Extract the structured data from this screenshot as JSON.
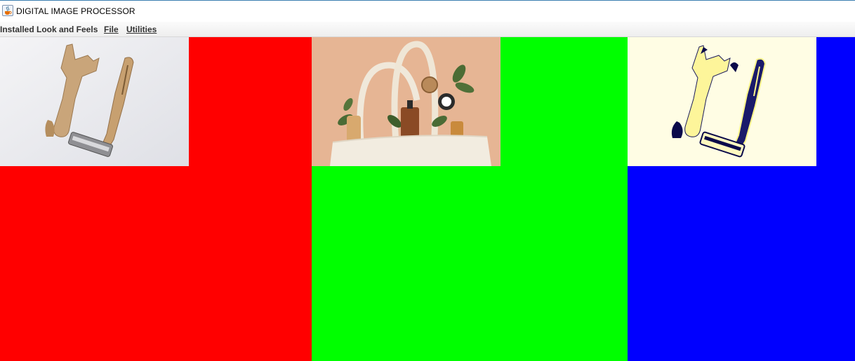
{
  "window": {
    "title": "DIGITAL IMAGE PROCESSOR",
    "icon": "java-cup-icon"
  },
  "menubar": {
    "items": [
      {
        "label": "Installed Look and Feels"
      },
      {
        "label": "File",
        "mnemonic": "F"
      },
      {
        "label": "Utilities",
        "mnemonic": "U"
      }
    ]
  },
  "panels": [
    {
      "name": "red-panel",
      "color": "#ff0000",
      "image": "razor-original-photo"
    },
    {
      "name": "green-panel",
      "color": "#00ff00",
      "image": "tote-bag-cosmetics-photo"
    },
    {
      "name": "blue-panel",
      "color": "#0000ff",
      "image": "razor-inverted-photo"
    }
  ]
}
